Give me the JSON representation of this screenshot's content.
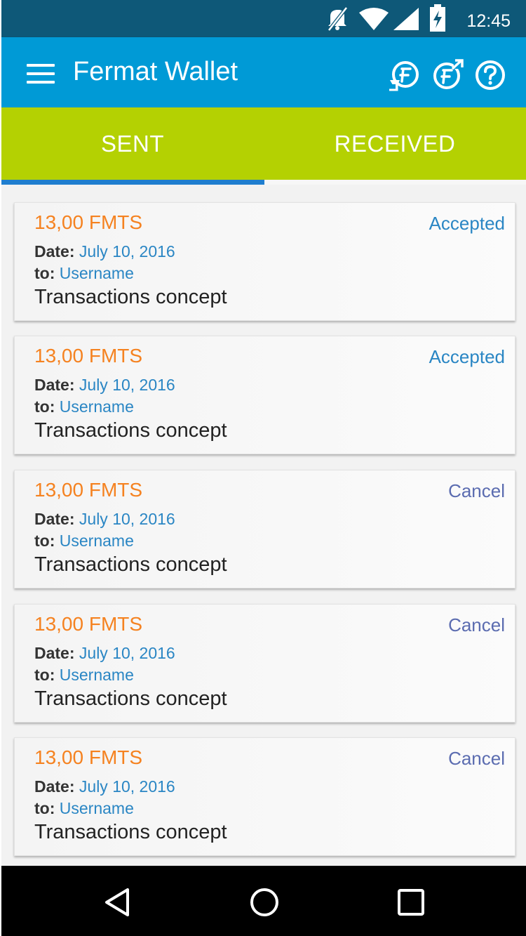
{
  "status_bar": {
    "time": "12:45",
    "icons": [
      "mute-icon",
      "wifi-icon",
      "signal-icon",
      "battery-charging-icon"
    ]
  },
  "app_bar": {
    "title": "Fermat Wallet",
    "actions": [
      "send-receive-icon",
      "send-icon",
      "help-icon"
    ],
    "background": "#009ad6"
  },
  "tabs": {
    "items": [
      {
        "label": "SENT",
        "active": true
      },
      {
        "label": "RECEIVED",
        "active": false
      }
    ],
    "background": "#b4d102",
    "indicator_color": "#1f7ecf"
  },
  "transactions": [
    {
      "amount": "13,00 FMTS",
      "status": "Accepted",
      "date_label": "Date:",
      "date": "July 10, 2016",
      "to_label": "to:",
      "to": "Username",
      "concept": "Transactions concept"
    },
    {
      "amount": "13,00 FMTS",
      "status": "Accepted",
      "date_label": "Date:",
      "date": "July 10, 2016",
      "to_label": "to:",
      "to": "Username",
      "concept": "Transactions concept"
    },
    {
      "amount": "13,00 FMTS",
      "status": "Cancel",
      "date_label": "Date:",
      "date": "July 10, 2016",
      "to_label": "to:",
      "to": "Username",
      "concept": "Transactions concept"
    },
    {
      "amount": "13,00 FMTS",
      "status": "Cancel",
      "date_label": "Date:",
      "date": "July 10, 2016",
      "to_label": "to:",
      "to": "Username",
      "concept": "Transactions concept"
    },
    {
      "amount": "13,00 FMTS",
      "status": "Cancel",
      "date_label": "Date:",
      "date": "July 10, 2016",
      "to_label": "to:",
      "to": "Username",
      "concept": "Transactions concept"
    }
  ],
  "colors": {
    "amount": "#f58220",
    "accepted": "#2a86c4",
    "cancel": "#5b6cb0"
  },
  "nav_bar": {
    "buttons": [
      "back-icon",
      "home-icon",
      "recents-icon"
    ]
  }
}
